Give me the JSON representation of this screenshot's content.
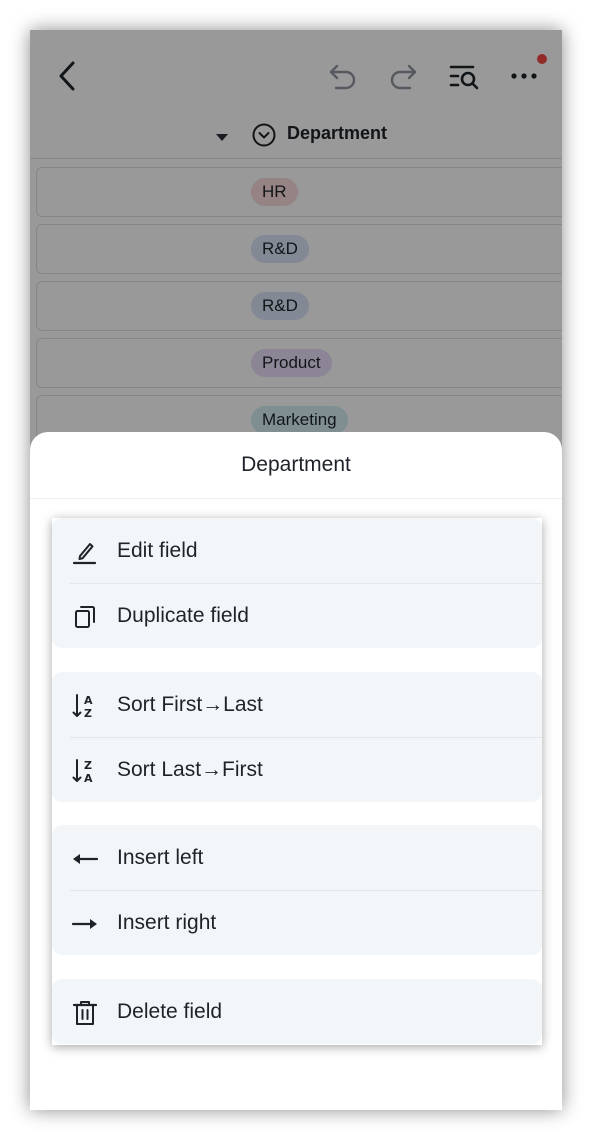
{
  "topbar": {
    "back_icon": "chevron-left-icon",
    "undo_icon": "undo-icon",
    "redo_icon": "redo-icon",
    "search_icon": "list-search-icon",
    "more_icon": "more-icon",
    "notification_color": "#f54a45"
  },
  "column_header": {
    "field_name": "Department",
    "field_type_icon": "single-select-icon"
  },
  "rows": [
    {
      "tag": "HR",
      "color": "#fbdada"
    },
    {
      "tag": "R&D",
      "color": "#d9e3f7"
    },
    {
      "tag": "R&D",
      "color": "#d9e3f7"
    },
    {
      "tag": "Product",
      "color": "#e9defa"
    },
    {
      "tag": "Marketing",
      "color": "#d3edf2"
    }
  ],
  "sheet": {
    "title": "Department",
    "groups": [
      {
        "items": [
          {
            "label": "Edit field",
            "icon": "edit-icon"
          },
          {
            "label": "Duplicate field",
            "icon": "duplicate-icon"
          }
        ]
      },
      {
        "items": [
          {
            "label": "Sort First→Last",
            "icon": "sort-ascending-icon"
          },
          {
            "label": "Sort Last→First",
            "icon": "sort-descending-icon"
          }
        ]
      },
      {
        "items": [
          {
            "label": "Insert left",
            "icon": "arrow-left-icon"
          },
          {
            "label": "Insert right",
            "icon": "arrow-right-icon"
          }
        ]
      },
      {
        "items": [
          {
            "label": "Delete field",
            "icon": "trash-icon"
          }
        ]
      }
    ]
  }
}
